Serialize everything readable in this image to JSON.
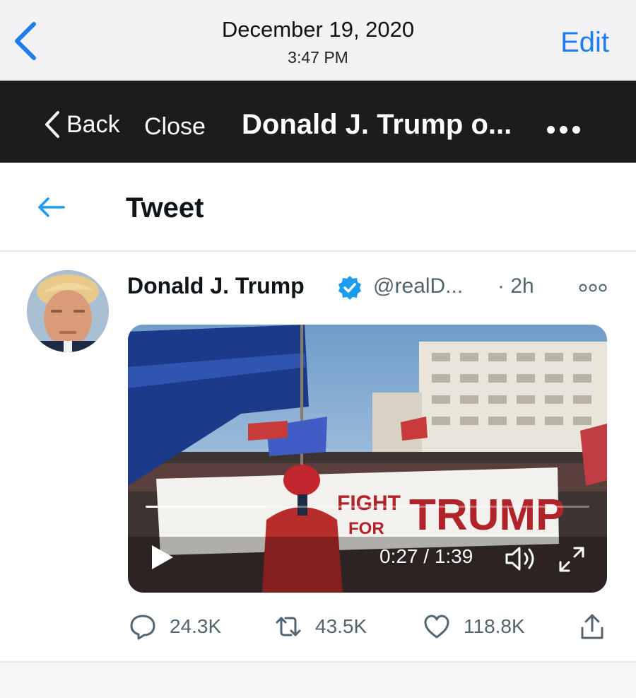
{
  "photos_bar": {
    "date": "December 19, 2020",
    "time": "3:47 PM",
    "edit_label": "Edit",
    "back_icon": "chevron-left-icon",
    "accent_color": "#1e7cf2"
  },
  "browser_bar": {
    "back_label": "Back",
    "close_label": "Close",
    "title": "Donald J. Trump o...",
    "more_icon": "ellipsis-icon",
    "background": "#1c1c1e"
  },
  "twitter_header": {
    "title": "Tweet",
    "back_icon": "arrow-left-icon",
    "accent_color": "#1d9bf0"
  },
  "tweet": {
    "author_name": "Donald J. Trump",
    "verified": true,
    "handle": "@realD...",
    "time": "· 2h",
    "more_icon": "more-horizontal-icon",
    "video": {
      "banner_text": "FIGHT FOR TRUMP",
      "current_time": "0:27",
      "duration": "1:39",
      "time_display": "0:27 / 1:39",
      "progress_fraction": 0.27,
      "play_icon": "play-icon",
      "volume_icon": "volume-icon",
      "fullscreen_icon": "fullscreen-icon"
    },
    "stats": {
      "replies": "24.3K",
      "retweets": "43.5K",
      "likes": "118.8K"
    }
  }
}
